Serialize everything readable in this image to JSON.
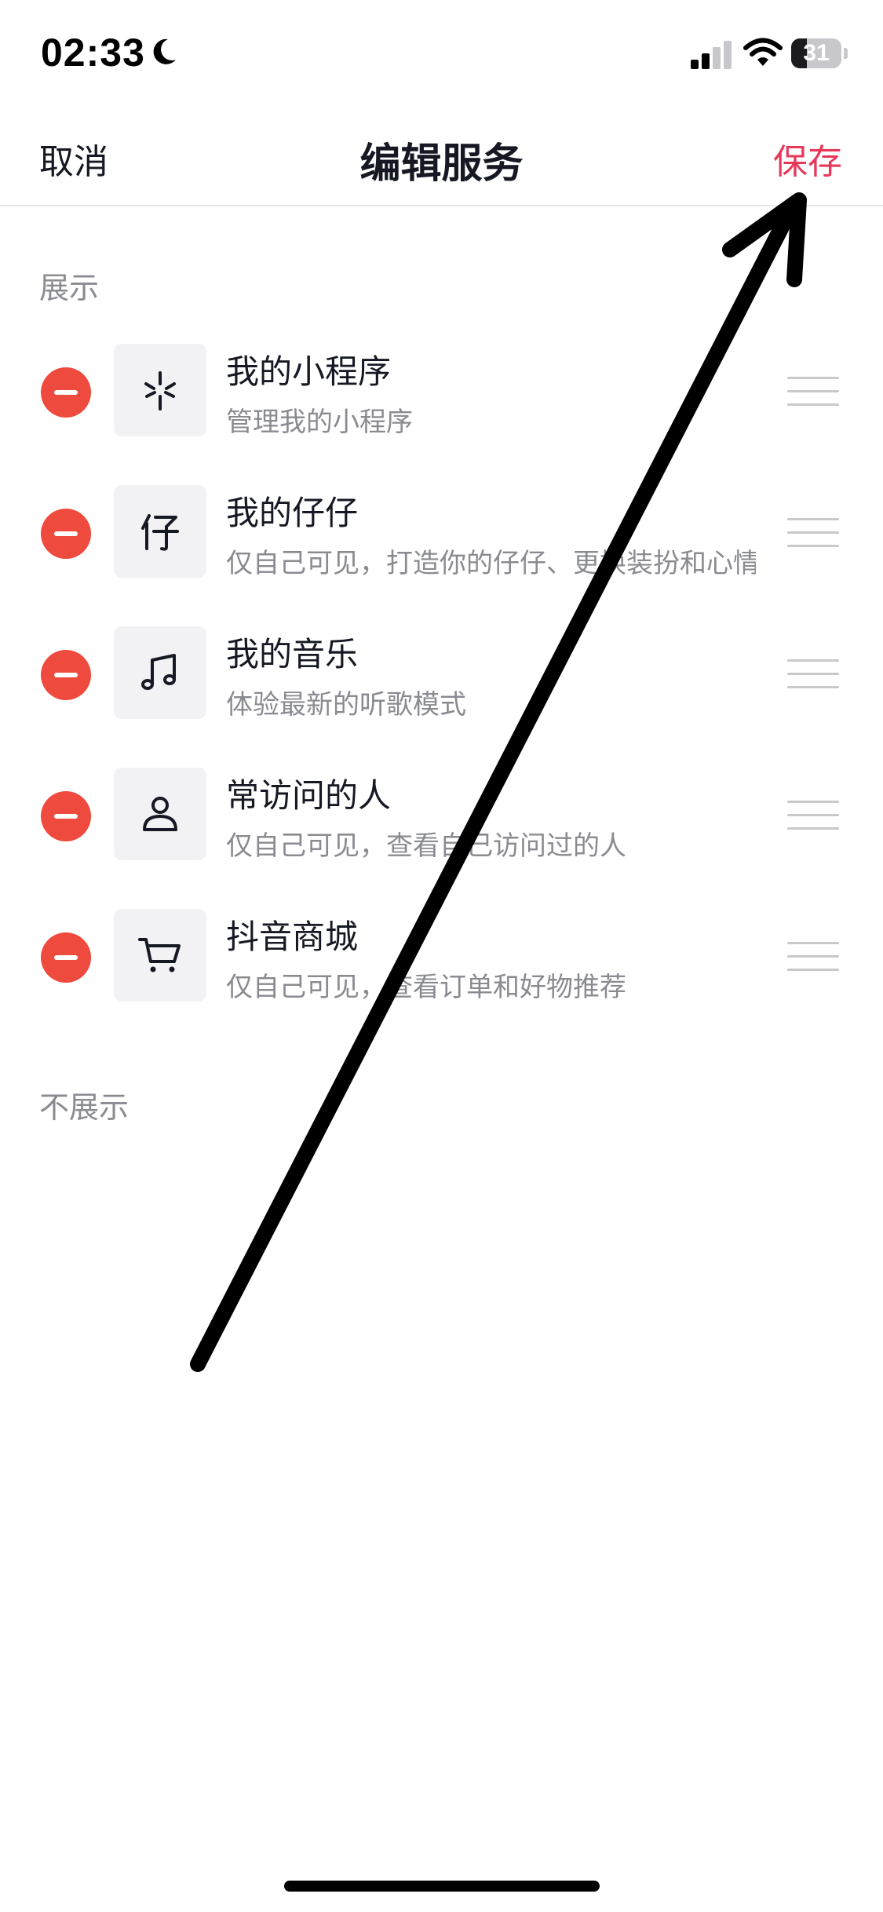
{
  "status_bar": {
    "time": "02:33",
    "battery_level": 31,
    "battery_text": "31",
    "icons": [
      "moon-icon",
      "signal-icon",
      "wifi-icon",
      "battery-icon"
    ]
  },
  "nav": {
    "cancel_label": "取消",
    "title": "编辑服务",
    "save_label": "保存"
  },
  "sections": {
    "shown_header": "展示",
    "hidden_header": "不展示"
  },
  "services": [
    {
      "title": "我的小程序",
      "desc": "管理我的小程序",
      "icon": "mini-program-icon"
    },
    {
      "title": "我的仔仔",
      "desc": "仅自己可见，打造你的仔仔、更换装扮和心情",
      "icon": "zaizai-icon"
    },
    {
      "title": "我的音乐",
      "desc": "体验最新的听歌模式",
      "icon": "music-note-icon"
    },
    {
      "title": "常访问的人",
      "desc": "仅自己可见，查看自己访问过的人",
      "icon": "person-icon"
    },
    {
      "title": "抖音商城",
      "desc": "仅自己可见，查看订单和好物推荐",
      "icon": "shopping-cart-icon"
    }
  ],
  "colors": {
    "accent_save": "#e8385a",
    "remove_red": "#ee4a3d",
    "text_primary": "#161823",
    "text_secondary": "#8a8b91"
  }
}
